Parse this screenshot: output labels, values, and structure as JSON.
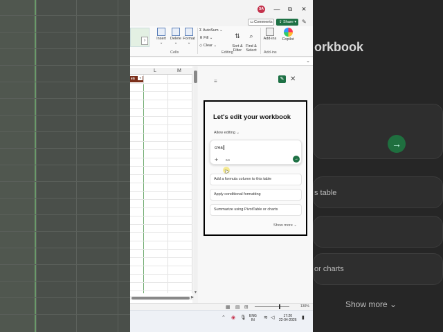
{
  "titlebar": {
    "avatar_initials": "SA",
    "minimize": "—",
    "restore": "⧉",
    "close": "✕"
  },
  "ribbon": {
    "comments_label": "Comments",
    "share_label": "Share",
    "insert_label": "Insert",
    "delete_label": "Delete",
    "format_label": "Format",
    "cells_group": "Cells",
    "autosum_label": "AutoSum",
    "fill_label": "Fill",
    "clear_label": "Clear",
    "sort_filter_label": "Sort &\nFilter",
    "find_select_label": "Find &\nSelect",
    "editing_group": "Editing",
    "addins_label": "Add-ins",
    "addins_group": "Add-ins",
    "copilot_label": "Copilot"
  },
  "sheet": {
    "column_l": "L",
    "column_m": "M",
    "header_cell_text": "en"
  },
  "copilot": {
    "headline": "Let's edit your workbook",
    "allow_editing": "Allow editing",
    "input_value": "crea",
    "suggestions": [
      "Add a formula column to this table",
      "Apply conditional formatting",
      "Summarize using PivotTable or charts"
    ],
    "show_more": "Show more"
  },
  "statusbar": {
    "zoom_pct": "130%"
  },
  "taskbar": {
    "lang_line1": "ENG",
    "lang_line2": "IN",
    "time": "17:20",
    "date": "22-04-2026"
  },
  "background": {
    "title_fragment": "orkbook",
    "line1": "s table",
    "line2": "or charts",
    "show_more": "Show more"
  }
}
